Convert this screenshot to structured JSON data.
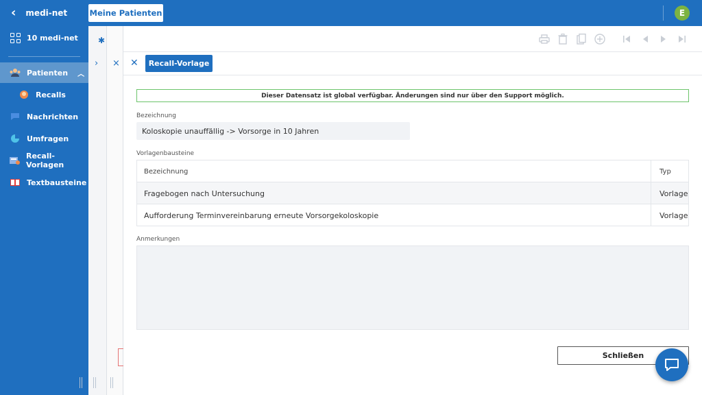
{
  "app": {
    "title": "medi-net",
    "patients_button": "Meine Patienten",
    "user_initial": "E",
    "accent": "#1f6fbf"
  },
  "sidebar": {
    "items": [
      {
        "label": "10 medi-net",
        "icon": "grid-icon"
      },
      {
        "label": "Patienten",
        "icon": "patients-icon",
        "active": true
      },
      {
        "label": "Recalls",
        "icon": "recalls-icon"
      },
      {
        "label": "Nachrichten",
        "icon": "message-icon"
      },
      {
        "label": "Umfragen",
        "icon": "pie-chart-icon"
      },
      {
        "label": "Recall-Vorlagen",
        "icon": "template-icon"
      },
      {
        "label": "Textbausteine",
        "icon": "book-icon"
      }
    ]
  },
  "dialog": {
    "tab_label": "Recall-Vorlage",
    "notice": "Dieser Datensatz ist global verfügbar. Änderungen sind nur über den Support möglich.",
    "bezeichnung_label": "Bezeichnung",
    "bezeichnung_value": "Koloskopie unauffällig -> Vorsorge in 10 Jahren",
    "bausteine_label": "Vorlagenbausteine",
    "table": {
      "headers": [
        "Bezeichnung",
        "Typ"
      ],
      "rows": [
        [
          "Fragebogen nach Untersuchung",
          "Vorlage"
        ],
        [
          "Aufforderung Terminvereinbarung erneute Vorsorgekoloskopie",
          "Vorlage"
        ]
      ]
    },
    "anmerkungen_label": "Anmerkungen",
    "close_label": "Schließen"
  }
}
